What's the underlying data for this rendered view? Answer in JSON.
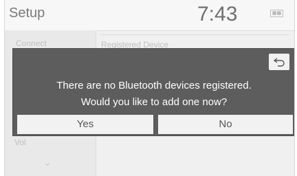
{
  "header": {
    "title": "Setup",
    "clock": "7:43"
  },
  "background": {
    "left_item": "Connect",
    "right_item": "Registered Device",
    "lower_item": "Vol"
  },
  "dialog": {
    "line1": "There are no Bluetooth devices registered.",
    "line2": "Would you like to add one now?",
    "yes_label": "Yes",
    "no_label": "No",
    "back_icon": "back-arrow-icon"
  }
}
